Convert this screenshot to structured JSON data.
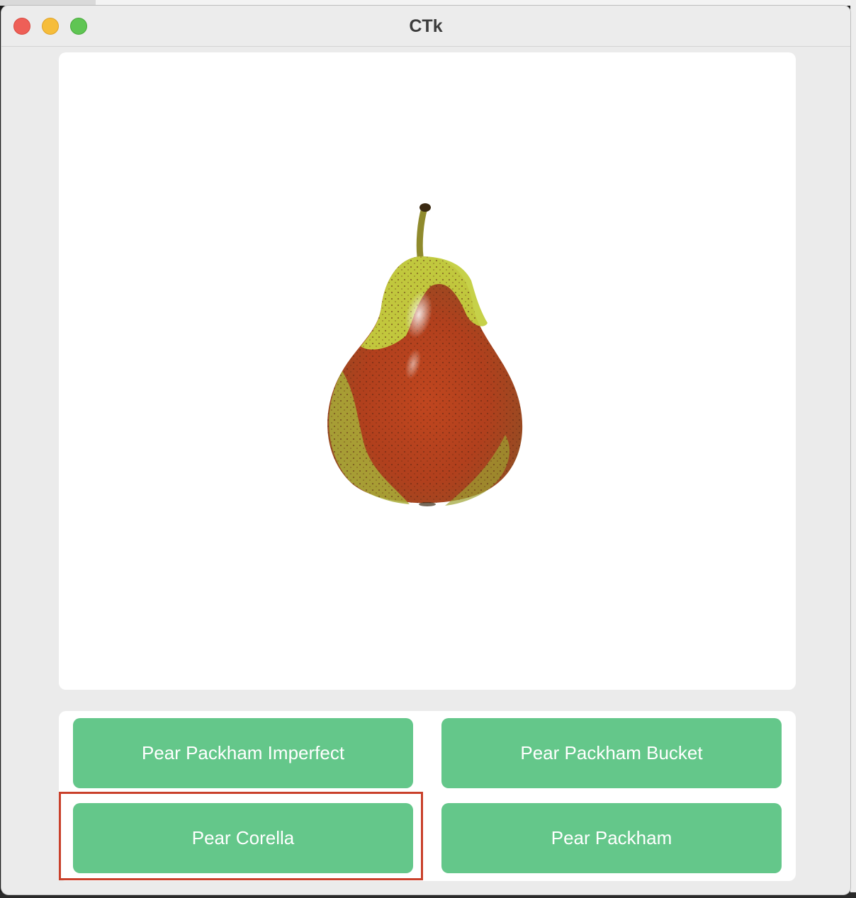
{
  "window": {
    "title": "CTk"
  },
  "image": {
    "subject": "pear-image",
    "colors": {
      "skin_red": "#b5401f",
      "skin_green": "#c4d24a",
      "stem": "#8a7a2a"
    }
  },
  "answers": [
    {
      "label": "Pear Packham Imperfect"
    },
    {
      "label": "Pear Packham Bucket"
    },
    {
      "label": "Pear Corella"
    },
    {
      "label": "Pear Packham"
    }
  ],
  "highlighted_answer": "Pear Corella",
  "colors": {
    "button": "#64c78a",
    "button_text": "#ffffff",
    "highlight": "#c9402a",
    "window_bg": "#ebebeb"
  }
}
